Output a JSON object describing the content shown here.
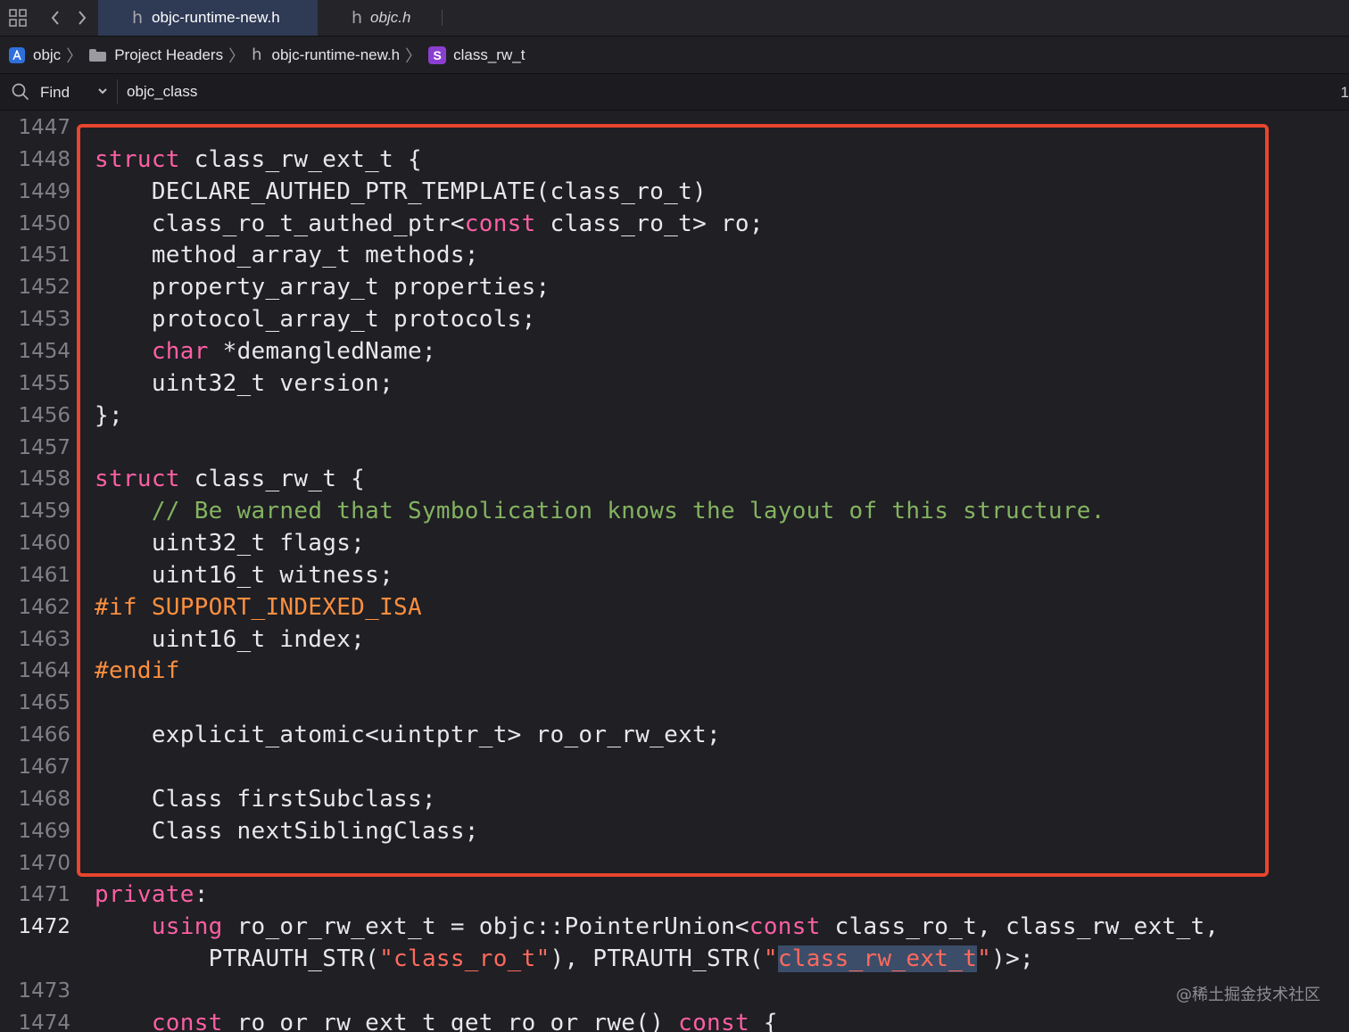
{
  "tabs": [
    {
      "label": "objc-runtime-new.h",
      "active": true
    },
    {
      "label": "objc.h",
      "active": false
    }
  ],
  "breadcrumb": {
    "project": "objc",
    "group": "Project Headers",
    "file": "objc-runtime-new.h",
    "symbol": "class_rw_t"
  },
  "find": {
    "mode": "Find",
    "query": "objc_class",
    "count": "1"
  },
  "editor": {
    "current_line": 1472,
    "line_numbers": [
      "1447",
      "1448",
      "1449",
      "1450",
      "1451",
      "1452",
      "1453",
      "1454",
      "1455",
      "1456",
      "1457",
      "1458",
      "1459",
      "1460",
      "1461",
      "1462",
      "1463",
      "1464",
      "1465",
      "1466",
      "1467",
      "1468",
      "1469",
      "1470",
      "1471",
      "1472",
      "",
      "1473",
      "1474"
    ],
    "code_lines": [
      [],
      [
        {
          "t": "struct",
          "c": "kw"
        },
        {
          "t": " class_rw_ext_t {"
        }
      ],
      [
        {
          "t": "    DECLARE_AUTHED_PTR_TEMPLATE(class_ro_t)"
        }
      ],
      [
        {
          "t": "    class_ro_t_authed_ptr<"
        },
        {
          "t": "const",
          "c": "kw"
        },
        {
          "t": " class_ro_t> ro;"
        }
      ],
      [
        {
          "t": "    method_array_t methods;"
        }
      ],
      [
        {
          "t": "    property_array_t properties;"
        }
      ],
      [
        {
          "t": "    protocol_array_t protocols;"
        }
      ],
      [
        {
          "t": "    "
        },
        {
          "t": "char",
          "c": "kw"
        },
        {
          "t": " *demangledName;"
        }
      ],
      [
        {
          "t": "    uint32_t version;"
        }
      ],
      [
        {
          "t": "};"
        }
      ],
      [],
      [
        {
          "t": "struct",
          "c": "kw"
        },
        {
          "t": " class_rw_t {"
        }
      ],
      [
        {
          "t": "    "
        },
        {
          "t": "// Be warned that Symbolication knows the layout of this structure.",
          "c": "cm"
        }
      ],
      [
        {
          "t": "    uint32_t flags;"
        }
      ],
      [
        {
          "t": "    uint16_t witness;"
        }
      ],
      [
        {
          "t": "#if SUPPORT_INDEXED_ISA",
          "c": "pp"
        }
      ],
      [
        {
          "t": "    uint16_t index;"
        }
      ],
      [
        {
          "t": "#endif",
          "c": "pp"
        }
      ],
      [],
      [
        {
          "t": "    explicit_atomic<uintptr_t> ro_or_rw_ext;"
        }
      ],
      [],
      [
        {
          "t": "    Class firstSubclass;"
        }
      ],
      [
        {
          "t": "    Class nextSiblingClass;"
        }
      ],
      [],
      [
        {
          "t": "private",
          "c": "kw"
        },
        {
          "t": ":"
        }
      ],
      [
        {
          "t": "    "
        },
        {
          "t": "using",
          "c": "kw"
        },
        {
          "t": " ro_or_rw_ext_t = objc::PointerUnion<"
        },
        {
          "t": "const",
          "c": "kw"
        },
        {
          "t": " class_ro_t, class_rw_ext_t,"
        }
      ],
      [
        {
          "t": "        PTRAUTH_STR("
        },
        {
          "t": "\"class_ro_t\"",
          "c": "st"
        },
        {
          "t": "), PTRAUTH_STR("
        },
        {
          "t": "\"",
          "c": "st"
        },
        {
          "t": "class_rw_ext_t",
          "c": "st hl"
        },
        {
          "t": "\"",
          "c": "st"
        },
        {
          "t": ")>;"
        }
      ],
      [],
      [
        {
          "t": "    "
        },
        {
          "t": "const",
          "c": "kw"
        },
        {
          "t": " ro_or_rw_ext_t get_ro_or_rwe() "
        },
        {
          "t": "const",
          "c": "kw"
        },
        {
          "t": " {"
        }
      ]
    ]
  },
  "watermark": "@稀土掘金技术社区",
  "colors": {
    "keyword": "#fc5fa3",
    "preprocessor": "#fd8f3f",
    "comment": "#84b360",
    "string": "#fc6a5d",
    "highlight_box": "#e8452f"
  }
}
